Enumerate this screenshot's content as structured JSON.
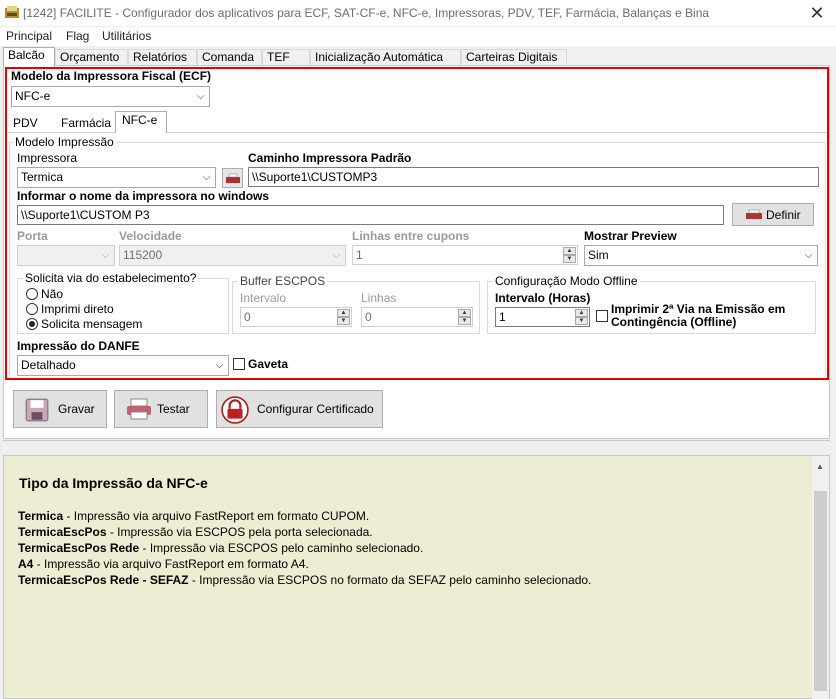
{
  "window": {
    "title": "[1242] FACILITE - Configurador dos aplicativos para ECF, SAT-CF-e, NFC-e, Impressoras, PDV, TEF, Farmácia, Balanças e Bina",
    "close": "✕"
  },
  "menu": [
    "Principal",
    "Flag",
    "Utilitários"
  ],
  "tabs": [
    "Balcão",
    "Orçamento",
    "Relatórios",
    "Comanda",
    "TEF",
    "Inicialização Automática",
    "Carteiras Digitais"
  ],
  "modelo": {
    "label": "Modelo da Impressora Fiscal (ECF)",
    "value": "NFC-e"
  },
  "subtabs": [
    "PDV",
    "Farmácia",
    "NFC-e"
  ],
  "modelo_impressao": {
    "group": "Modelo Impressão",
    "impressora_label": "Impressora",
    "impressora_value": "Termica",
    "caminho_label": "Caminho Impressora Padrão",
    "caminho_value": "\\\\Suporte1\\CUSTOMP3",
    "windows_label": "Informar o nome da impressora no windows",
    "windows_value": "\\\\Suporte1\\CUSTOM P3",
    "definir": "Definir",
    "porta_label": "Porta",
    "porta_value": "",
    "velocidade_label": "Velocidade",
    "velocidade_value": "115200",
    "linhas_label": "Linhas entre cupons",
    "linhas_value": "1",
    "preview_label": "Mostrar Preview",
    "preview_value": "Sim"
  },
  "via": {
    "label": "Solicita via do estabelecimento?",
    "options": [
      "Não",
      "Imprimi direto",
      "Solicita mensagem"
    ],
    "selected": 2
  },
  "buffer": {
    "label": "Buffer ESCPOS",
    "intervalo_label": "Intervalo",
    "intervalo_value": "0",
    "linhas_label": "Linhas",
    "linhas_value": "0"
  },
  "offline": {
    "label": "Configuração Modo Offline",
    "intervalo_label": "Intervalo (Horas)",
    "intervalo_value": "1",
    "check_label_1": "Imprimir 2ª Via na Emissão em",
    "check_label_2": "Contingência (Offline)"
  },
  "danfe": {
    "label": "Impressão do DANFE",
    "value": "Detalhado",
    "gaveta": "Gaveta"
  },
  "buttons": {
    "gravar": "Gravar",
    "testar": "Testar",
    "certificado": "Configurar Certificado"
  },
  "info": {
    "title": "Tipo da Impressão da NFC-e",
    "lines": [
      {
        "b": "Termica",
        "t": " - Impressão via arquivo FastReport em formato CUPOM."
      },
      {
        "b": "TermicaEscPos",
        "t": " - Impressão via ESCPOS pela porta selecionada."
      },
      {
        "b": "TermicaEscPos Rede",
        "t": " - Impressão via ESCPOS pelo caminho selecionado."
      },
      {
        "b": "A4",
        "t": " - Impressão via arquivo FastReport em formato A4."
      },
      {
        "b": "TermicaEscPos Rede - SEFAZ",
        "t": " - Impressão via ESCPOS no formato da SEFAZ pelo caminho selecionado."
      }
    ]
  },
  "colors": {
    "highlight_border": "#e00000",
    "info_bg": "#ededd4"
  }
}
